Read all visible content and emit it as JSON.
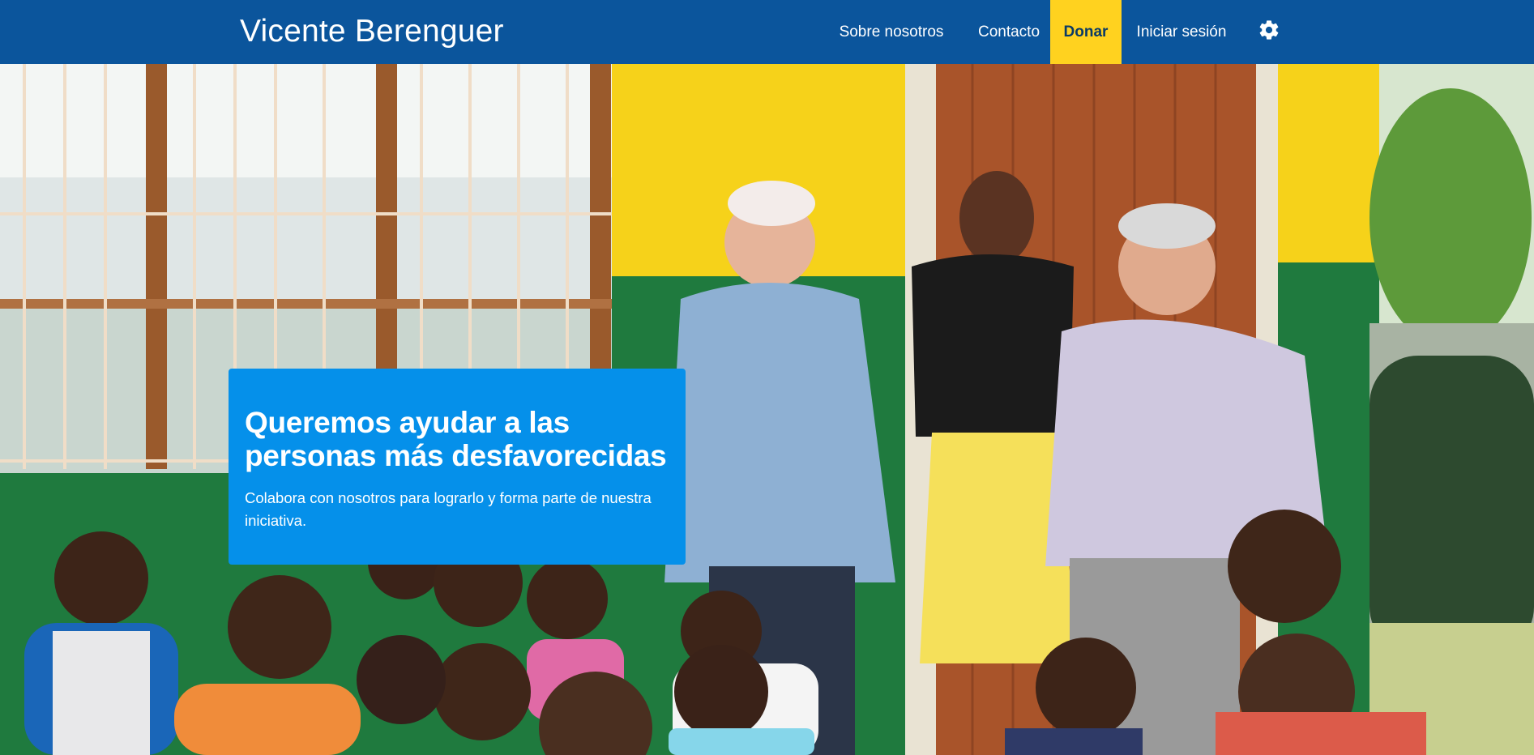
{
  "header": {
    "brand": "Vicente Berenguer",
    "nav": {
      "about": "Sobre nosotros",
      "contact": "Contacto",
      "donate": "Donar",
      "login": "Iniciar sesión"
    },
    "settings_icon": "gear-icon"
  },
  "hero": {
    "title": "Queremos ayudar a las personas más desfavorecidas",
    "text": "Colabora con nosotros para lograrlo y forma parte de nuestra iniciativa.",
    "image_description_icon": "photo"
  },
  "colors": {
    "header_bg": "#0b559c",
    "donate_bg": "#ffd21f",
    "card_bg": "#0590ea",
    "text_light": "#ffffff"
  }
}
